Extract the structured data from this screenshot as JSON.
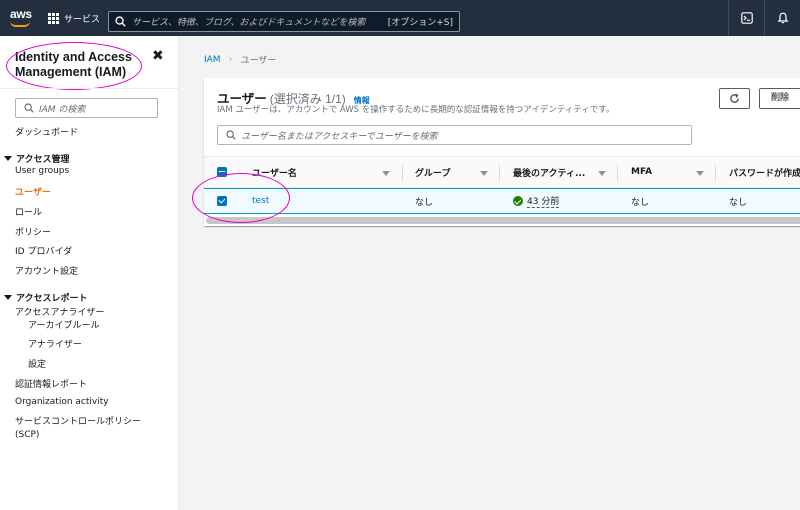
{
  "topbar": {
    "logo": "aws",
    "services_label": "サービス",
    "search_placeholder": "サービス、特徴、ブログ、およびドキュメントなどを検索",
    "search_shortcut": "[オプション+S]",
    "icons": [
      "terminal-icon",
      "bell-icon"
    ]
  },
  "sidebar": {
    "title": "Identity and Access Management (IAM)",
    "close": "✖",
    "search_placeholder": "IAM の検索",
    "dashboard": "ダッシュボード",
    "access_management": {
      "label": "アクセス管理",
      "items": [
        "User groups",
        "ユーザー",
        "ロール",
        "ポリシー",
        "ID プロバイダ",
        "アカウント設定"
      ],
      "active": "ユーザー"
    },
    "access_reports": {
      "label": "アクセスレポート",
      "analyzer": "アクセスアナライザー",
      "analyzer_items": [
        "アーカイブルール",
        "アナライザー",
        "設定"
      ],
      "items": [
        "認証情報レポート",
        "Organization activity",
        "サービスコントロールポリシー (SCP)"
      ]
    }
  },
  "breadcrumb": {
    "root": "IAM",
    "current": "ユーザー"
  },
  "panel": {
    "title": "ユーザー",
    "count": "(選択済み 1/1)",
    "info": "情報",
    "description": "IAM ユーザーは、アカウントで AWS を操作するために長期的な認証情報を持つアイデンティティです。",
    "delete_label": "削除",
    "search_placeholder": "ユーザー名またはアクセスキーでユーザーを検索"
  },
  "table": {
    "columns": [
      "ユーザー名",
      "グループ",
      "最後のアクティ...",
      "MFA",
      "パスワードが作成"
    ],
    "rows": [
      {
        "selected": true,
        "username": "test",
        "groups": "なし",
        "last_activity": "43 分前",
        "mfa": "なし",
        "password": "なし"
      }
    ]
  },
  "colors": {
    "accent": "#ec7211",
    "link": "#0073bb",
    "topbar": "#232f3e",
    "annotation": "#e100c8"
  }
}
